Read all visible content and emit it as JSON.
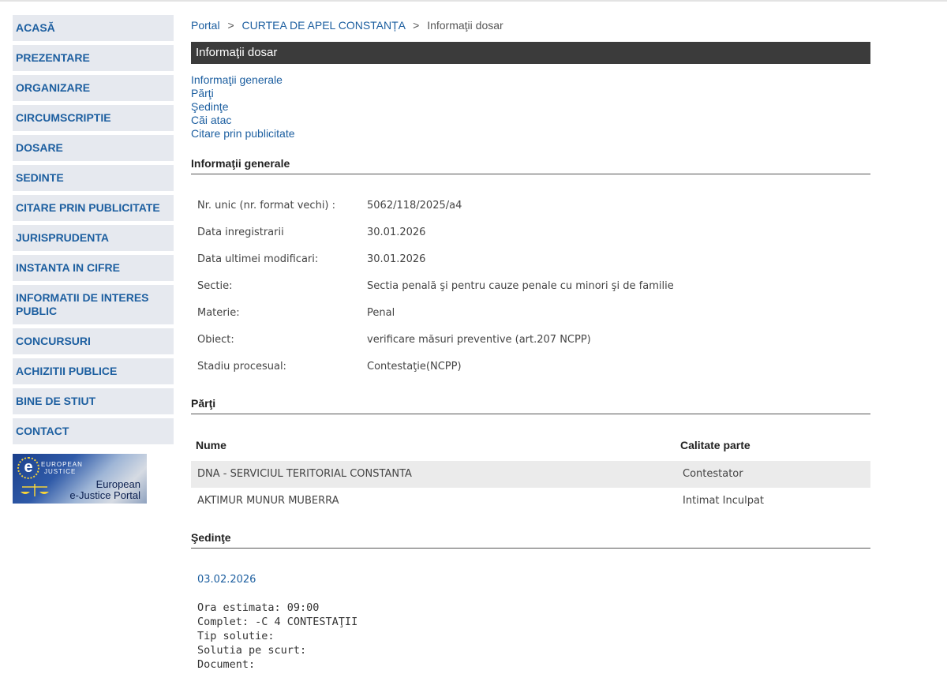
{
  "sidebar": {
    "items": [
      {
        "label": "ACASĂ"
      },
      {
        "label": "PREZENTARE"
      },
      {
        "label": "ORGANIZARE"
      },
      {
        "label": "CIRCUMSCRIPTIE"
      },
      {
        "label": "DOSARE"
      },
      {
        "label": "SEDINTE"
      },
      {
        "label": "CITARE PRIN PUBLICITATE"
      },
      {
        "label": "JURISPRUDENTA"
      },
      {
        "label": "INSTANTA IN CIFRE"
      },
      {
        "label": "INFORMATII DE INTERES PUBLIC"
      },
      {
        "label": "CONCURSURI"
      },
      {
        "label": "ACHIZITII PUBLICE"
      },
      {
        "label": "BINE DE STIUT"
      },
      {
        "label": "CONTACT"
      }
    ],
    "ejustice": {
      "badge": "e",
      "line1": "EUROPEAN",
      "line2": "JUSTICE",
      "title1": "European",
      "title2": "e-Justice Portal"
    }
  },
  "breadcrumb": {
    "portal": "Portal",
    "sep1": ">",
    "court": "CURTEA DE APEL CONSTANȚA",
    "sep2": ">",
    "current": "Informaţii dosar"
  },
  "title_bar": "Informaţii dosar",
  "anchors": [
    "Informaţii generale",
    "Părţi",
    "Şedinţe",
    "Căi atac",
    "Citare prin publicitate"
  ],
  "info": {
    "heading": "Informaţii generale",
    "rows": [
      {
        "label": "Nr. unic (nr. format vechi) :",
        "value": "5062/118/2025/a4"
      },
      {
        "label": "Data inregistrarii",
        "value": "30.01.2026"
      },
      {
        "label": "Data ultimei modificari:",
        "value": "30.01.2026"
      },
      {
        "label": "Sectie:",
        "value": "Sectia penală şi pentru cauze penale cu minori şi de familie"
      },
      {
        "label": "Materie:",
        "value": "Penal"
      },
      {
        "label": "Obiect:",
        "value": "verificare măsuri preventive (art.207 NCPP)"
      },
      {
        "label": "Stadiu procesual:",
        "value": "Contestaţie(NCPP)"
      }
    ]
  },
  "parti": {
    "heading": "Părţi",
    "col_name": "Nume",
    "col_role": "Calitate parte",
    "rows": [
      {
        "name": "DNA - SERVICIUL TERITORIAL CONSTANTA",
        "role": "Contestator"
      },
      {
        "name": "AKTIMUR MUNUR MUBERRA",
        "role": "Intimat Inculpat"
      }
    ]
  },
  "sedinte": {
    "heading": "Şedinţe",
    "date": "03.02.2026",
    "details": [
      "Ora estimata: 09:00",
      "Complet: -C 4 CONTESTAŢII",
      "Tip solutie:",
      "Solutia pe scurt:",
      "Document:"
    ]
  }
}
